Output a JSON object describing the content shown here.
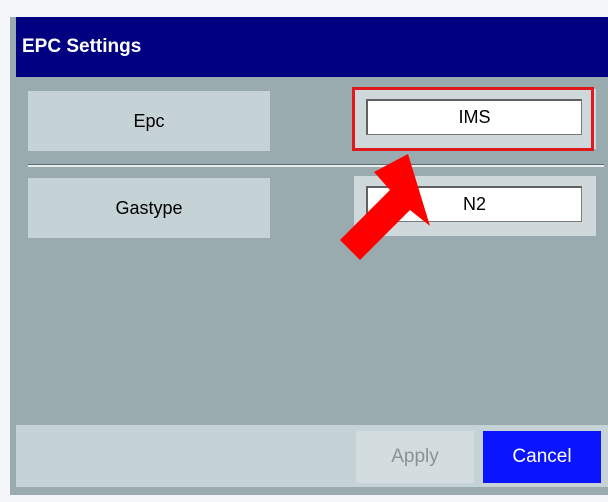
{
  "dialog": {
    "title": "EPC Settings"
  },
  "rows": [
    {
      "label": "Epc",
      "value": "IMS"
    },
    {
      "label": "Gastype",
      "value": "N2"
    }
  ],
  "footer": {
    "apply_label": "Apply",
    "cancel_label": "Cancel"
  },
  "colors": {
    "titlebar": "#000080",
    "panel": "#9aabb0",
    "highlight": "#e0191c",
    "annotation_arrow": "#ff0000",
    "cancel_button": "#0a14ff"
  }
}
